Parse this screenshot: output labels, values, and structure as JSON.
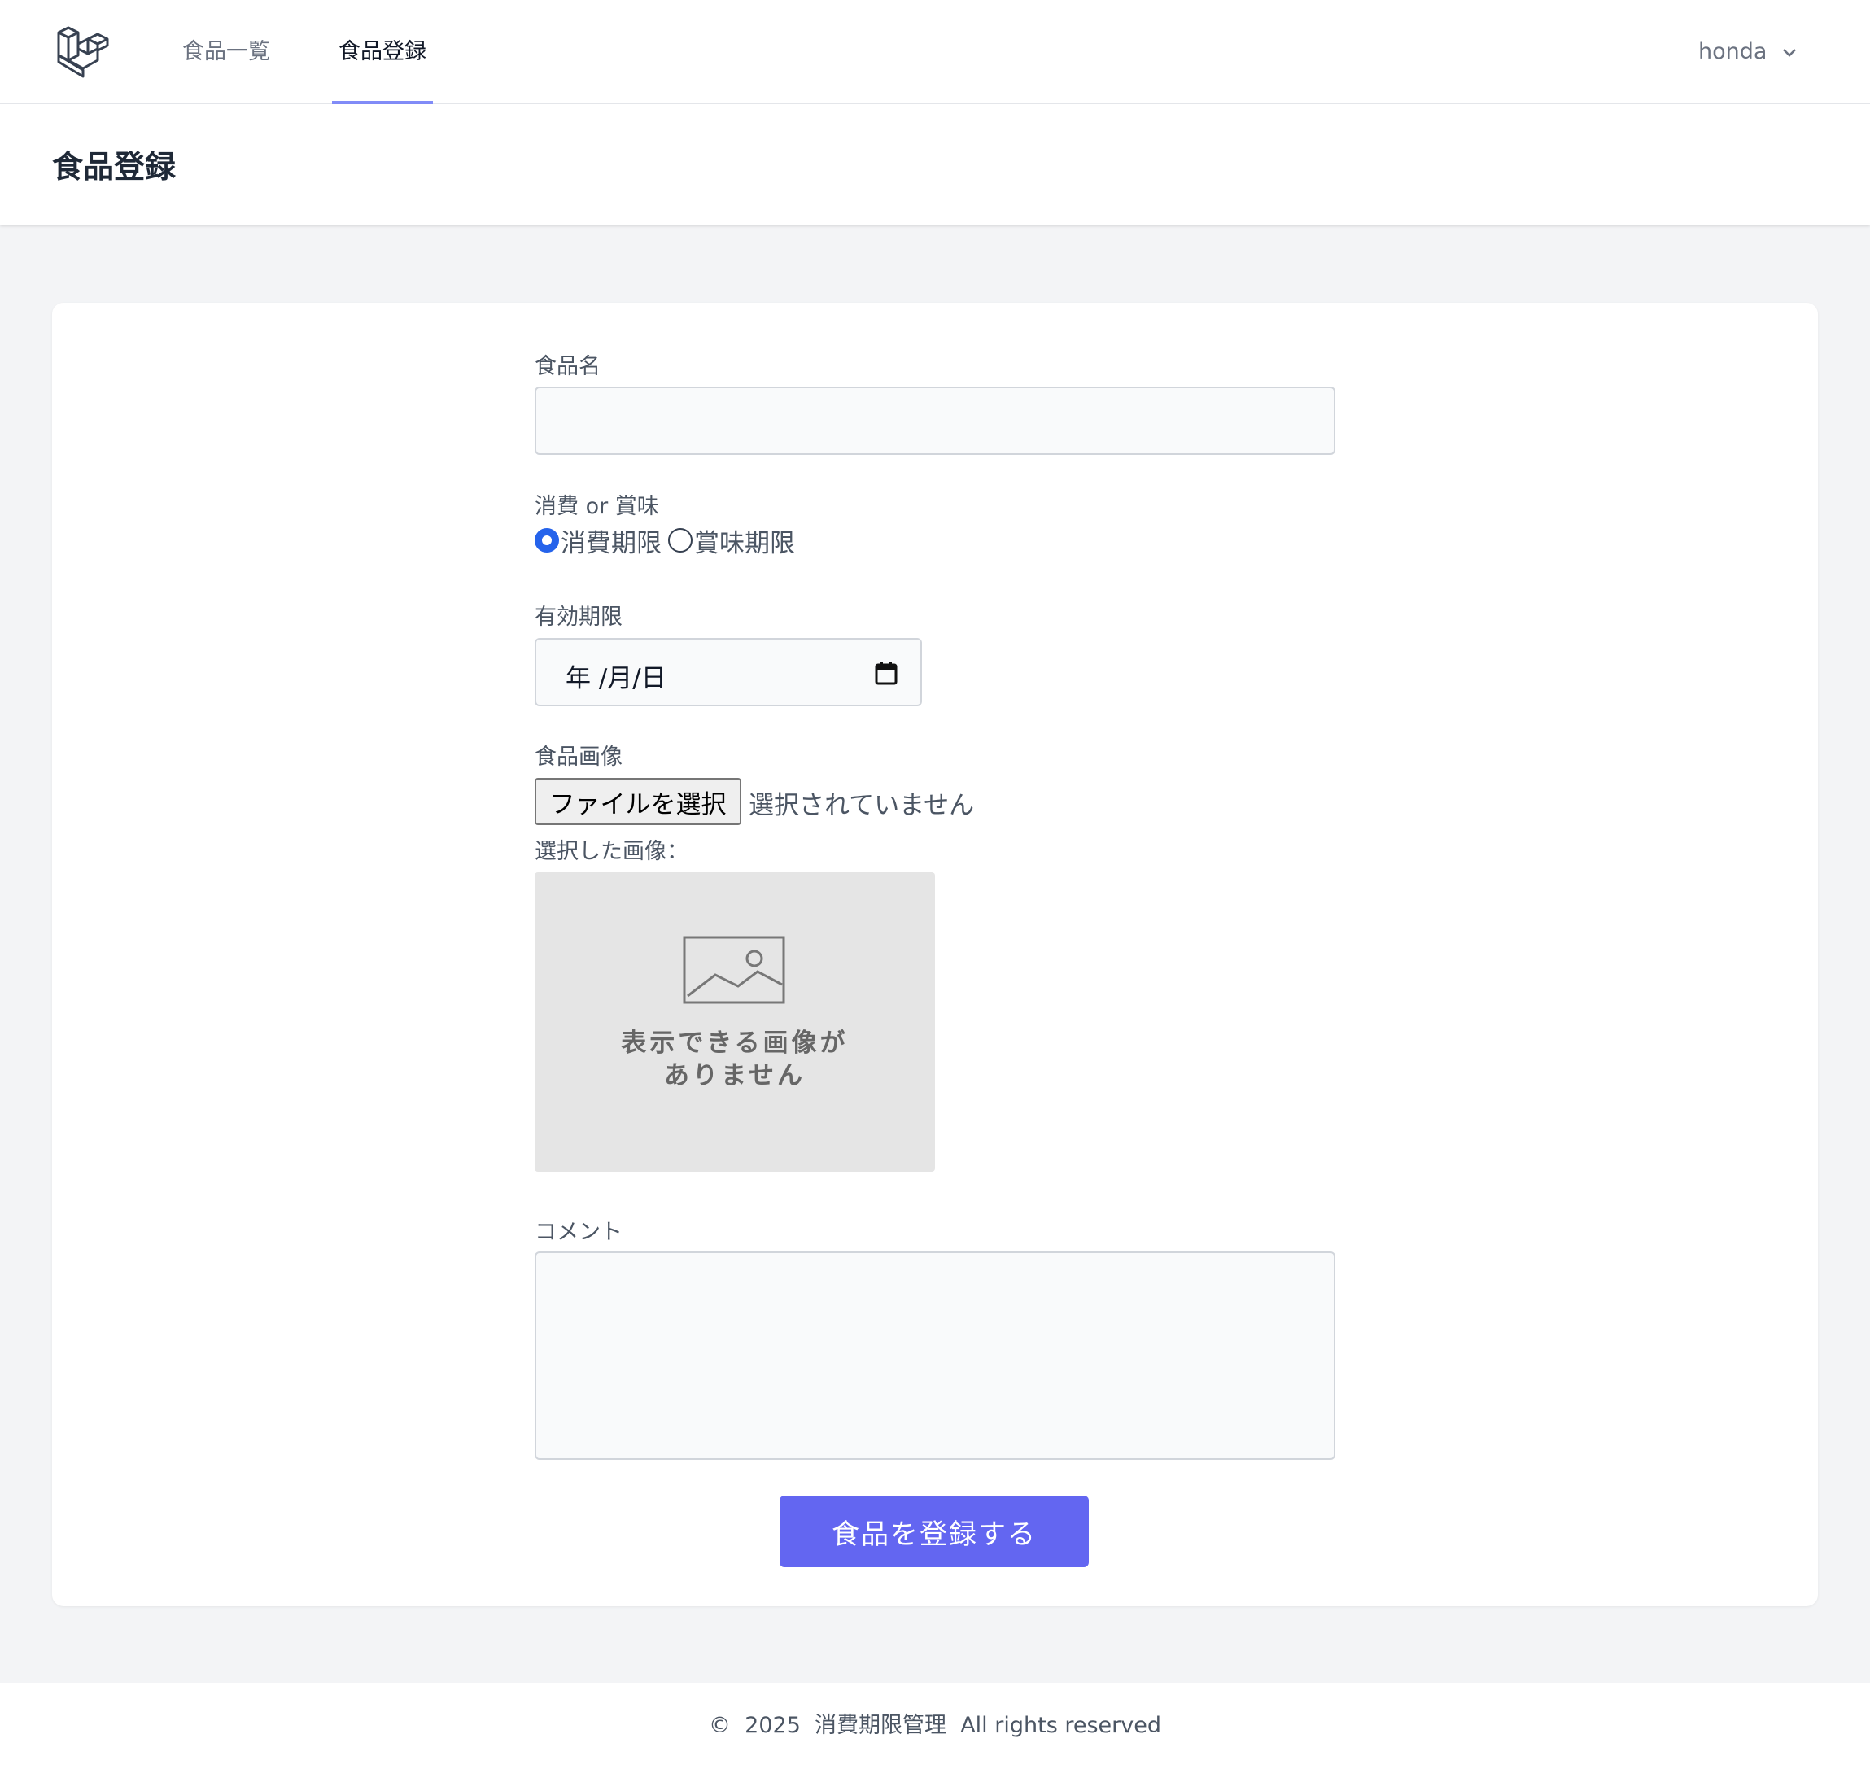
{
  "nav": {
    "links": [
      {
        "label": "食品一覧",
        "active": false
      },
      {
        "label": "食品登録",
        "active": true
      }
    ],
    "user": {
      "name": "honda",
      "icon": "chevron-down-icon"
    },
    "logo_icon": "laravel-logo-icon"
  },
  "header": {
    "title": "食品登録"
  },
  "form": {
    "name_label": "食品名",
    "name_value": "",
    "type_label": "消費 or 賞味",
    "type_options": [
      {
        "label": "消費期限",
        "checked": true
      },
      {
        "label": "賞味期限",
        "checked": false
      }
    ],
    "date_label": "有効期限",
    "date_placeholder": "年 /月/日",
    "image_label": "食品画像",
    "file_button": "ファイルを選択",
    "file_status": "選択されていません",
    "preview_label": "選択した画像：",
    "no_image_line1": "表示できる画像が",
    "no_image_line2": "ありません",
    "comment_label": "コメント",
    "comment_value": "",
    "submit_label": "食品を登録する"
  },
  "footer": {
    "text": "©  2025  消費期限管理  All rights reserved"
  },
  "colors": {
    "accent": "#6366f1",
    "nav_active_border": "#818cf8",
    "radio_checked": "#2563eb",
    "page_bg": "#f3f4f6"
  }
}
